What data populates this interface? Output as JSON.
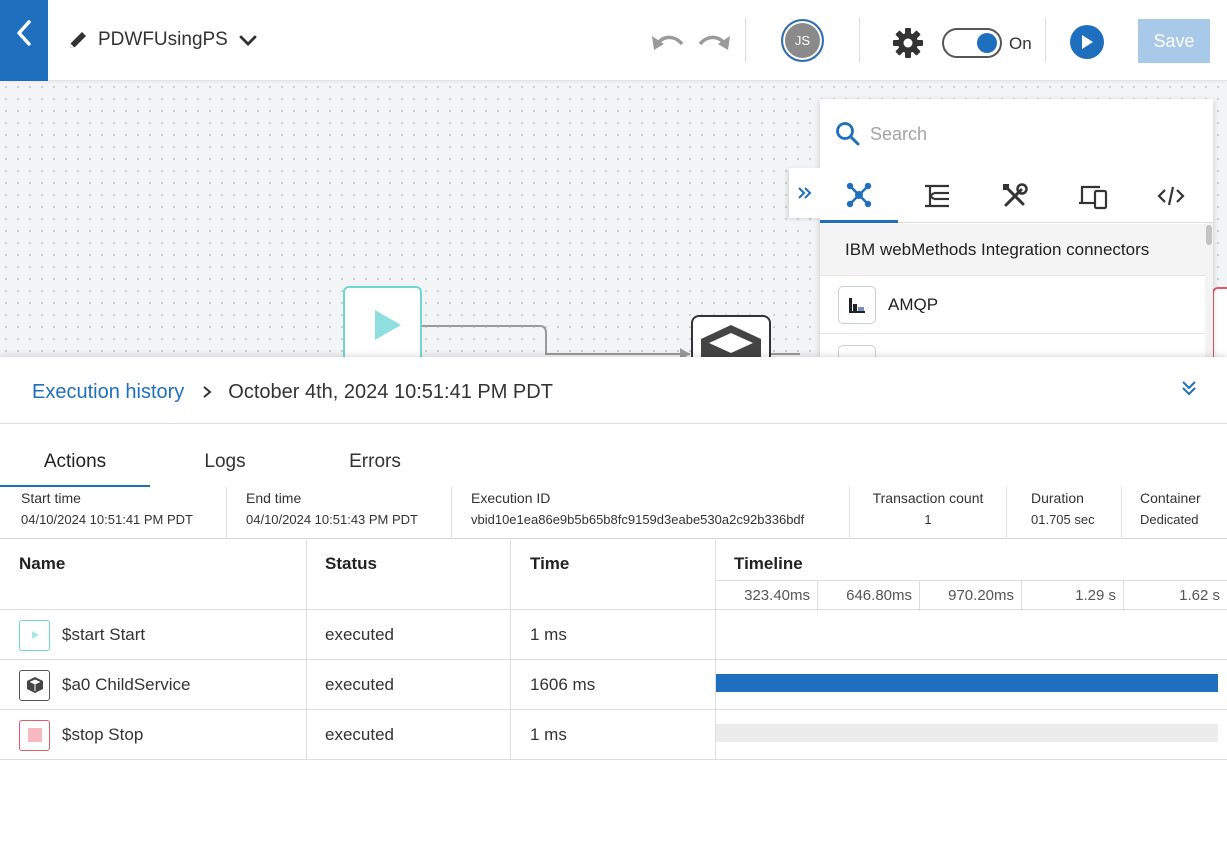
{
  "header": {
    "workflow_name": "PDWFUsingPS",
    "avatar_initials": "JS",
    "toggle_label": "On",
    "save_label": "Save"
  },
  "palette": {
    "search_placeholder": "Search",
    "category_icons": [
      "connectors-icon",
      "flow-control-icon",
      "tools-icon",
      "devices-icon",
      "code-icon"
    ],
    "section_title": "IBM webMethods Integration connectors",
    "items": [
      {
        "label": "AMQP",
        "icon": "amqp-icon"
      }
    ]
  },
  "execution": {
    "breadcrumb_link": "Execution history",
    "breadcrumb_current": "October 4th, 2024 10:51:41 PM PDT",
    "tabs": [
      "Actions",
      "Logs",
      "Errors"
    ],
    "active_tab": "Actions",
    "meta": [
      {
        "label": "Start time",
        "value": "04/10/2024 10:51:41 PM PDT"
      },
      {
        "label": "End time",
        "value": "04/10/2024 10:51:43 PM PDT"
      },
      {
        "label": "Execution ID",
        "value": "vbid10e1ea86e9b5b65b8fc9159d3eabe530a2c92b336bdf"
      },
      {
        "label": "Transaction count",
        "value": "1"
      },
      {
        "label": "Duration",
        "value": "01.705 sec"
      },
      {
        "label": "Container",
        "value": "Dedicated"
      }
    ],
    "columns": [
      "Name",
      "Status",
      "Time",
      "Timeline"
    ],
    "timeline_ticks": [
      "323.40ms",
      "646.80ms",
      "970.20ms",
      "1.29 s",
      "1.62 s"
    ],
    "rows": [
      {
        "name": "$start Start",
        "status": "executed",
        "time": "1 ms",
        "icon": "start-icon",
        "timeline_fraction": 0,
        "bar_color": ""
      },
      {
        "name": "$a0 ChildService",
        "status": "executed",
        "time": "1606 ms",
        "icon": "service-cube-icon",
        "timeline_fraction": 1.0,
        "bar_color": "#1f6fbf"
      },
      {
        "name": "$stop Stop",
        "status": "executed",
        "time": "1 ms",
        "icon": "stop-icon",
        "timeline_fraction": 1.0,
        "bar_color": "#ececec"
      }
    ]
  },
  "colors": {
    "accent": "#1f6fbf",
    "save_disabled": "#a9c9e8",
    "start_node": "#6fd6d6",
    "stop_node": "#e35b66"
  }
}
